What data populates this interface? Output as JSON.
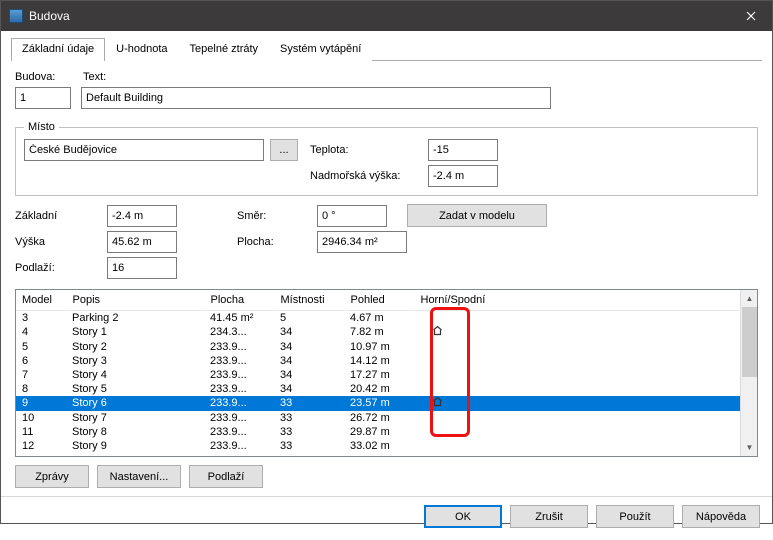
{
  "window": {
    "title": "Budova"
  },
  "tabs": [
    "Základní údaje",
    "U-hodnota",
    "Tepelné ztráty",
    "Systém vytápění"
  ],
  "form": {
    "budova_label": "Budova:",
    "text_label": "Text:",
    "budova_value": "1",
    "text_value": "Default Building",
    "misto_label": "Místo",
    "misto_value": "České Budějovice",
    "teplota_label": "Teplota:",
    "teplota_value": "-15",
    "nadmorska_label": "Nadmořská výška:",
    "nadmorska_value": "-2.4 m",
    "zakladni_label": "Základní",
    "zakladni_value": "-2.4 m",
    "smer_label": "Směr:",
    "smer_value": "0 °",
    "zadat_button": "Zadat v modelu",
    "vyska_label": "Výška",
    "vyska_value": "45.62 m",
    "plocha_label": "Plocha:",
    "plocha_value": "2946.34 m²",
    "podlazi_label": "Podlaží:",
    "podlazi_value": "16"
  },
  "table": {
    "headers": [
      "Model",
      "Popis",
      "Plocha",
      "Místnosti",
      "Pohled",
      "Horní/Spodní"
    ],
    "rows": [
      {
        "model": "3",
        "popis": "Parking 2",
        "plocha": "41.45 m²",
        "mist": "5",
        "pohled": "4.67 m",
        "icon": false,
        "selected": false
      },
      {
        "model": "4",
        "popis": "Story 1",
        "plocha": "234.3...",
        "mist": "34",
        "pohled": "7.82 m",
        "icon": true,
        "selected": false
      },
      {
        "model": "5",
        "popis": "Story 2",
        "plocha": "233.9...",
        "mist": "34",
        "pohled": "10.97 m",
        "icon": false,
        "selected": false
      },
      {
        "model": "6",
        "popis": "Story 3",
        "plocha": "233.9...",
        "mist": "34",
        "pohled": "14.12 m",
        "icon": false,
        "selected": false
      },
      {
        "model": "7",
        "popis": "Story 4",
        "plocha": "233.9...",
        "mist": "34",
        "pohled": "17.27 m",
        "icon": false,
        "selected": false
      },
      {
        "model": "8",
        "popis": "Story 5",
        "plocha": "233.9...",
        "mist": "34",
        "pohled": "20.42 m",
        "icon": false,
        "selected": false
      },
      {
        "model": "9",
        "popis": "Story 6",
        "plocha": "233.9...",
        "mist": "33",
        "pohled": "23.57 m",
        "icon": true,
        "selected": true
      },
      {
        "model": "10",
        "popis": "Story 7",
        "plocha": "233.9...",
        "mist": "33",
        "pohled": "26.72 m",
        "icon": false,
        "selected": false
      },
      {
        "model": "11",
        "popis": "Story 8",
        "plocha": "233.9...",
        "mist": "33",
        "pohled": "29.87 m",
        "icon": false,
        "selected": false
      },
      {
        "model": "12",
        "popis": "Story 9",
        "plocha": "233.9...",
        "mist": "33",
        "pohled": "33.02 m",
        "icon": false,
        "selected": false
      }
    ]
  },
  "buttons": {
    "zpravy": "Zprávy",
    "nastaveni": "Nastavení...",
    "podlazi": "Podlaží",
    "ok": "OK",
    "cancel": "Zrušit",
    "apply": "Použít",
    "help": "Nápověda"
  }
}
